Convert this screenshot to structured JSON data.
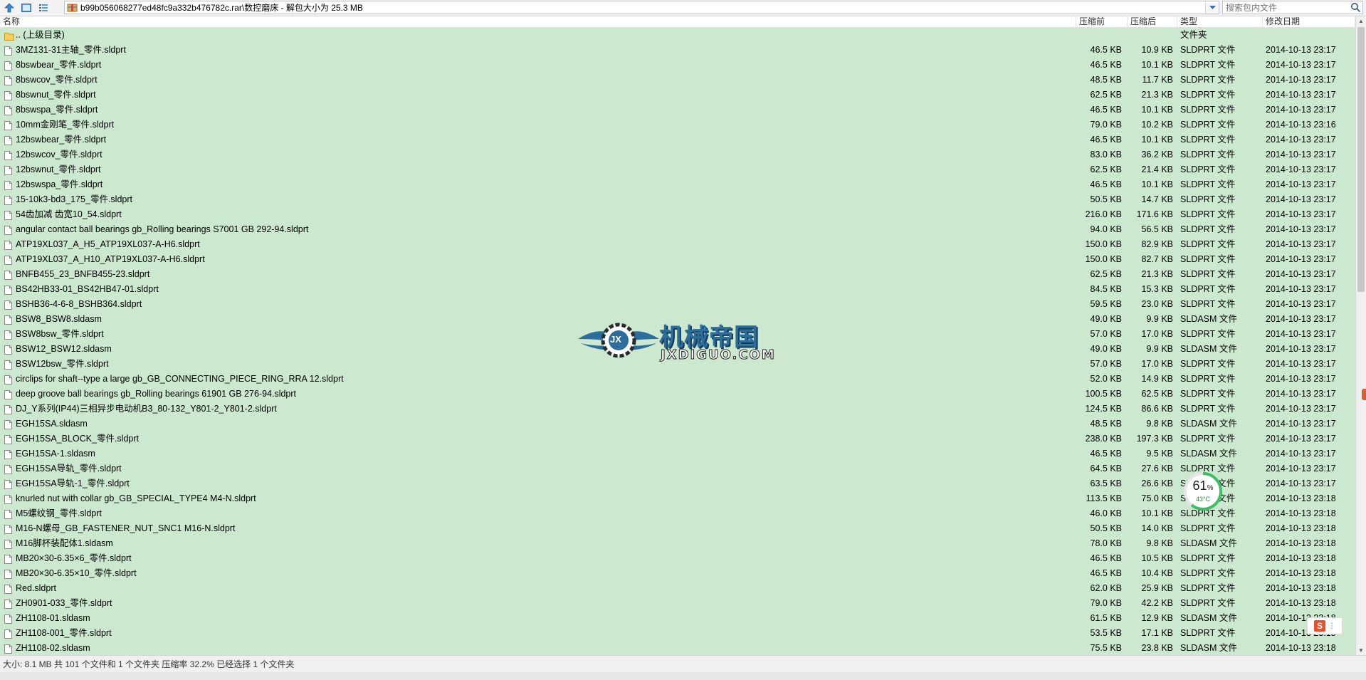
{
  "address_bar": {
    "path": "b99b056068277ed48fc9a332b476782c.rar\\数控磨床 - 解包大小为 25.3 MB"
  },
  "search": {
    "placeholder": "搜索包内文件"
  },
  "columns": {
    "name": "名称",
    "compressed": "压缩前",
    "uncompressed": "压缩后",
    "type": "类型",
    "modified": "修改日期"
  },
  "rows": [
    {
      "name": ".. (上级目录)",
      "compressed": "",
      "uncompressed": "",
      "type": "文件夹",
      "modified": "",
      "icon": "folder-icon"
    },
    {
      "name": "3MZ131-31主轴_零件.sldprt",
      "compressed": "46.5 KB",
      "uncompressed": "10.9 KB",
      "type": "SLDPRT 文件",
      "modified": "2014-10-13 23:17",
      "icon": "file-icon"
    },
    {
      "name": "8bswbear_零件.sldprt",
      "compressed": "46.5 KB",
      "uncompressed": "10.1 KB",
      "type": "SLDPRT 文件",
      "modified": "2014-10-13 23:17",
      "icon": "file-icon"
    },
    {
      "name": "8bswcov_零件.sldprt",
      "compressed": "48.5 KB",
      "uncompressed": "11.7 KB",
      "type": "SLDPRT 文件",
      "modified": "2014-10-13 23:17",
      "icon": "file-icon"
    },
    {
      "name": "8bswnut_零件.sldprt",
      "compressed": "62.5 KB",
      "uncompressed": "21.3 KB",
      "type": "SLDPRT 文件",
      "modified": "2014-10-13 23:17",
      "icon": "file-icon"
    },
    {
      "name": "8bswspa_零件.sldprt",
      "compressed": "46.5 KB",
      "uncompressed": "10.1 KB",
      "type": "SLDPRT 文件",
      "modified": "2014-10-13 23:17",
      "icon": "file-icon"
    },
    {
      "name": "10mm金刚笔_零件.sldprt",
      "compressed": "79.0 KB",
      "uncompressed": "10.2 KB",
      "type": "SLDPRT 文件",
      "modified": "2014-10-13 23:16",
      "icon": "file-icon"
    },
    {
      "name": "12bswbear_零件.sldprt",
      "compressed": "46.5 KB",
      "uncompressed": "10.1 KB",
      "type": "SLDPRT 文件",
      "modified": "2014-10-13 23:17",
      "icon": "file-icon"
    },
    {
      "name": "12bswcov_零件.sldprt",
      "compressed": "83.0 KB",
      "uncompressed": "36.2 KB",
      "type": "SLDPRT 文件",
      "modified": "2014-10-13 23:17",
      "icon": "file-icon"
    },
    {
      "name": "12bswnut_零件.sldprt",
      "compressed": "62.5 KB",
      "uncompressed": "21.4 KB",
      "type": "SLDPRT 文件",
      "modified": "2014-10-13 23:17",
      "icon": "file-icon"
    },
    {
      "name": "12bswspa_零件.sldprt",
      "compressed": "46.5 KB",
      "uncompressed": "10.1 KB",
      "type": "SLDPRT 文件",
      "modified": "2014-10-13 23:17",
      "icon": "file-icon"
    },
    {
      "name": "15-10k3-bd3_175_零件.sldprt",
      "compressed": "50.5 KB",
      "uncompressed": "14.7 KB",
      "type": "SLDPRT 文件",
      "modified": "2014-10-13 23:17",
      "icon": "file-icon"
    },
    {
      "name": "54齿加减 齿宽10_54.sldprt",
      "compressed": "216.0 KB",
      "uncompressed": "171.6 KB",
      "type": "SLDPRT 文件",
      "modified": "2014-10-13 23:17",
      "icon": "file-icon"
    },
    {
      "name": "angular contact ball bearings gb_Rolling bearings S7001 GB 292-94.sldprt",
      "compressed": "94.0 KB",
      "uncompressed": "56.5 KB",
      "type": "SLDPRT 文件",
      "modified": "2014-10-13 23:17",
      "icon": "file-icon"
    },
    {
      "name": "ATP19XL037_A_H5_ATP19XL037-A-H6.sldprt",
      "compressed": "150.0 KB",
      "uncompressed": "82.9 KB",
      "type": "SLDPRT 文件",
      "modified": "2014-10-13 23:17",
      "icon": "file-icon"
    },
    {
      "name": "ATP19XL037_A_H10_ATP19XL037-A-H6.sldprt",
      "compressed": "150.0 KB",
      "uncompressed": "82.7 KB",
      "type": "SLDPRT 文件",
      "modified": "2014-10-13 23:17",
      "icon": "file-icon"
    },
    {
      "name": "BNFB455_23_BNFB455-23.sldprt",
      "compressed": "62.5 KB",
      "uncompressed": "21.3 KB",
      "type": "SLDPRT 文件",
      "modified": "2014-10-13 23:17",
      "icon": "file-icon"
    },
    {
      "name": "BS42HB33-01_BS42HB47-01.sldprt",
      "compressed": "84.5 KB",
      "uncompressed": "15.3 KB",
      "type": "SLDPRT 文件",
      "modified": "2014-10-13 23:17",
      "icon": "file-icon"
    },
    {
      "name": "BSHB36-4-6-8_BSHB364.sldprt",
      "compressed": "59.5 KB",
      "uncompressed": "23.0 KB",
      "type": "SLDPRT 文件",
      "modified": "2014-10-13 23:17",
      "icon": "file-icon"
    },
    {
      "name": "BSW8_BSW8.sldasm",
      "compressed": "49.0 KB",
      "uncompressed": "9.9 KB",
      "type": "SLDASM 文件",
      "modified": "2014-10-13 23:17",
      "icon": "file-icon"
    },
    {
      "name": "BSW8bsw_零件.sldprt",
      "compressed": "57.0 KB",
      "uncompressed": "17.0 KB",
      "type": "SLDPRT 文件",
      "modified": "2014-10-13 23:17",
      "icon": "file-icon"
    },
    {
      "name": "BSW12_BSW12.sldasm",
      "compressed": "49.0 KB",
      "uncompressed": "9.9 KB",
      "type": "SLDASM 文件",
      "modified": "2014-10-13 23:17",
      "icon": "file-icon"
    },
    {
      "name": "BSW12bsw_零件.sldprt",
      "compressed": "57.0 KB",
      "uncompressed": "17.0 KB",
      "type": "SLDPRT 文件",
      "modified": "2014-10-13 23:17",
      "icon": "file-icon"
    },
    {
      "name": "circlips for shaft--type a large gb_GB_CONNECTING_PIECE_RING_RRA 12.sldprt",
      "compressed": "52.0 KB",
      "uncompressed": "14.9 KB",
      "type": "SLDPRT 文件",
      "modified": "2014-10-13 23:17",
      "icon": "file-icon"
    },
    {
      "name": "deep groove ball bearings gb_Rolling bearings 61901 GB 276-94.sldprt",
      "compressed": "100.5 KB",
      "uncompressed": "62.5 KB",
      "type": "SLDPRT 文件",
      "modified": "2014-10-13 23:17",
      "icon": "file-icon"
    },
    {
      "name": "DJ_Y系列(IP44)三相异步电动机B3_80-132_Y801-2_Y801-2.sldprt",
      "compressed": "124.5 KB",
      "uncompressed": "86.6 KB",
      "type": "SLDPRT 文件",
      "modified": "2014-10-13 23:17",
      "icon": "file-icon"
    },
    {
      "name": "EGH15SA.sldasm",
      "compressed": "48.5 KB",
      "uncompressed": "9.8 KB",
      "type": "SLDASM 文件",
      "modified": "2014-10-13 23:17",
      "icon": "file-icon"
    },
    {
      "name": "EGH15SA_BLOCK_零件.sldprt",
      "compressed": "238.0 KB",
      "uncompressed": "197.3 KB",
      "type": "SLDPRT 文件",
      "modified": "2014-10-13 23:17",
      "icon": "file-icon"
    },
    {
      "name": "EGH15SA-1.sldasm",
      "compressed": "46.5 KB",
      "uncompressed": "9.5 KB",
      "type": "SLDASM 文件",
      "modified": "2014-10-13 23:17",
      "icon": "file-icon"
    },
    {
      "name": "EGH15SA导轨_零件.sldprt",
      "compressed": "64.5 KB",
      "uncompressed": "27.6 KB",
      "type": "SLDPRT 文件",
      "modified": "2014-10-13 23:17",
      "icon": "file-icon"
    },
    {
      "name": "EGH15SA导轨-1_零件.sldprt",
      "compressed": "63.5 KB",
      "uncompressed": "26.6 KB",
      "type": "SLDPRT 文件",
      "modified": "2014-10-13 23:17",
      "icon": "file-icon"
    },
    {
      "name": "knurled nut with collar gb_GB_SPECIAL_TYPE4 M4-N.sldprt",
      "compressed": "113.5 KB",
      "uncompressed": "75.0 KB",
      "type": "SLDPRT 文件",
      "modified": "2014-10-13 23:18",
      "icon": "file-icon"
    },
    {
      "name": "M5螺纹钢_零件.sldprt",
      "compressed": "46.0 KB",
      "uncompressed": "10.1 KB",
      "type": "SLDPRT 文件",
      "modified": "2014-10-13 23:18",
      "icon": "file-icon"
    },
    {
      "name": "M16-N螺母_GB_FASTENER_NUT_SNC1 M16-N.sldprt",
      "compressed": "50.5 KB",
      "uncompressed": "14.0 KB",
      "type": "SLDPRT 文件",
      "modified": "2014-10-13 23:18",
      "icon": "file-icon"
    },
    {
      "name": "M16脚杯装配体1.sldasm",
      "compressed": "78.0 KB",
      "uncompressed": "9.8 KB",
      "type": "SLDASM 文件",
      "modified": "2014-10-13 23:18",
      "icon": "file-icon"
    },
    {
      "name": "MB20×30-6.35×6_零件.sldprt",
      "compressed": "46.5 KB",
      "uncompressed": "10.5 KB",
      "type": "SLDPRT 文件",
      "modified": "2014-10-13 23:18",
      "icon": "file-icon"
    },
    {
      "name": "MB20×30-6.35×10_零件.sldprt",
      "compressed": "46.5 KB",
      "uncompressed": "10.4 KB",
      "type": "SLDPRT 文件",
      "modified": "2014-10-13 23:18",
      "icon": "file-icon"
    },
    {
      "name": "Red.sldprt",
      "compressed": "62.0 KB",
      "uncompressed": "25.9 KB",
      "type": "SLDPRT 文件",
      "modified": "2014-10-13 23:18",
      "icon": "file-icon"
    },
    {
      "name": "ZH0901-033_零件.sldprt",
      "compressed": "79.0 KB",
      "uncompressed": "42.2 KB",
      "type": "SLDPRT 文件",
      "modified": "2014-10-13 23:18",
      "icon": "file-icon"
    },
    {
      "name": "ZH1108-01.sldasm",
      "compressed": "61.5 KB",
      "uncompressed": "12.9 KB",
      "type": "SLDASM 文件",
      "modified": "2014-10-13 23:18",
      "icon": "file-icon"
    },
    {
      "name": "ZH1108-001_零件.sldprt",
      "compressed": "53.5 KB",
      "uncompressed": "17.1 KB",
      "type": "SLDPRT 文件",
      "modified": "2014-10-13 23:18",
      "icon": "file-icon"
    },
    {
      "name": "ZH1108-02.sldasm",
      "compressed": "75.5 KB",
      "uncompressed": "23.8 KB",
      "type": "SLDASM 文件",
      "modified": "2014-10-13 23:18",
      "icon": "file-icon"
    }
  ],
  "status_bar": {
    "text": "大小: 8.1 MB 共 101 个文件和 1 个文件夹 压缩率 32.2% 已经选择 1 个文件夹"
  },
  "watermark": {
    "title": "机械帝国",
    "url": "JXDIGUO.COM",
    "emblem": "JX"
  },
  "perf_widget": {
    "value": "61",
    "unit": "%",
    "temp": "43°C"
  },
  "ime_indicator": {
    "label": "S"
  },
  "colors": {
    "list_bg": "#cce8cf",
    "accent": "#1a6fb0",
    "watermark_blue": "#2b6e9e"
  }
}
